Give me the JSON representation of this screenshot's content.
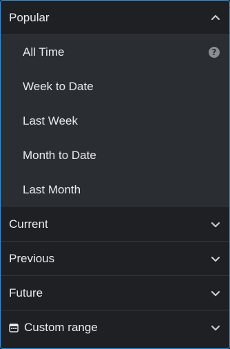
{
  "sections": {
    "popular": {
      "label": "Popular",
      "items": [
        {
          "label": "All Time"
        },
        {
          "label": "Week to Date"
        },
        {
          "label": "Last Week"
        },
        {
          "label": "Month to Date"
        },
        {
          "label": "Last Month"
        }
      ],
      "help_glyph": "?"
    },
    "current": {
      "label": "Current"
    },
    "previous": {
      "label": "Previous"
    },
    "future": {
      "label": "Future"
    },
    "custom_range": {
      "label": "Custom range"
    }
  },
  "colors": {
    "background": "#1e2024",
    "expanded_background": "#2a2d32",
    "text": "#e9ecef",
    "border_accent": "#2f8fd8"
  },
  "icons": {
    "expanded": "chevron-up-icon",
    "collapsed": "chevron-down-icon",
    "help": "question-circle-icon",
    "custom_range": "calendar-icon"
  }
}
